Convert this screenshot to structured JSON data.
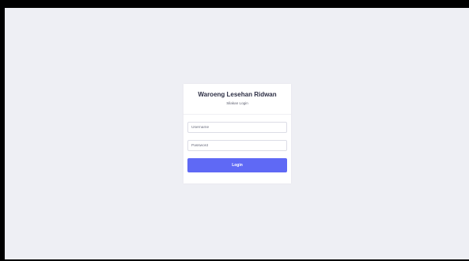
{
  "login_card": {
    "title": "Waroeng Lesehan Ridwan",
    "subtitle": "Silakan Login",
    "username": {
      "value": "",
      "placeholder": "Username"
    },
    "password": {
      "value": "",
      "placeholder": "Password"
    },
    "login_label": "Login",
    "button_color": "#5f69f5"
  },
  "colors": {
    "background": "#eeeff4",
    "card": "#ffffff",
    "frame": "#000000"
  }
}
